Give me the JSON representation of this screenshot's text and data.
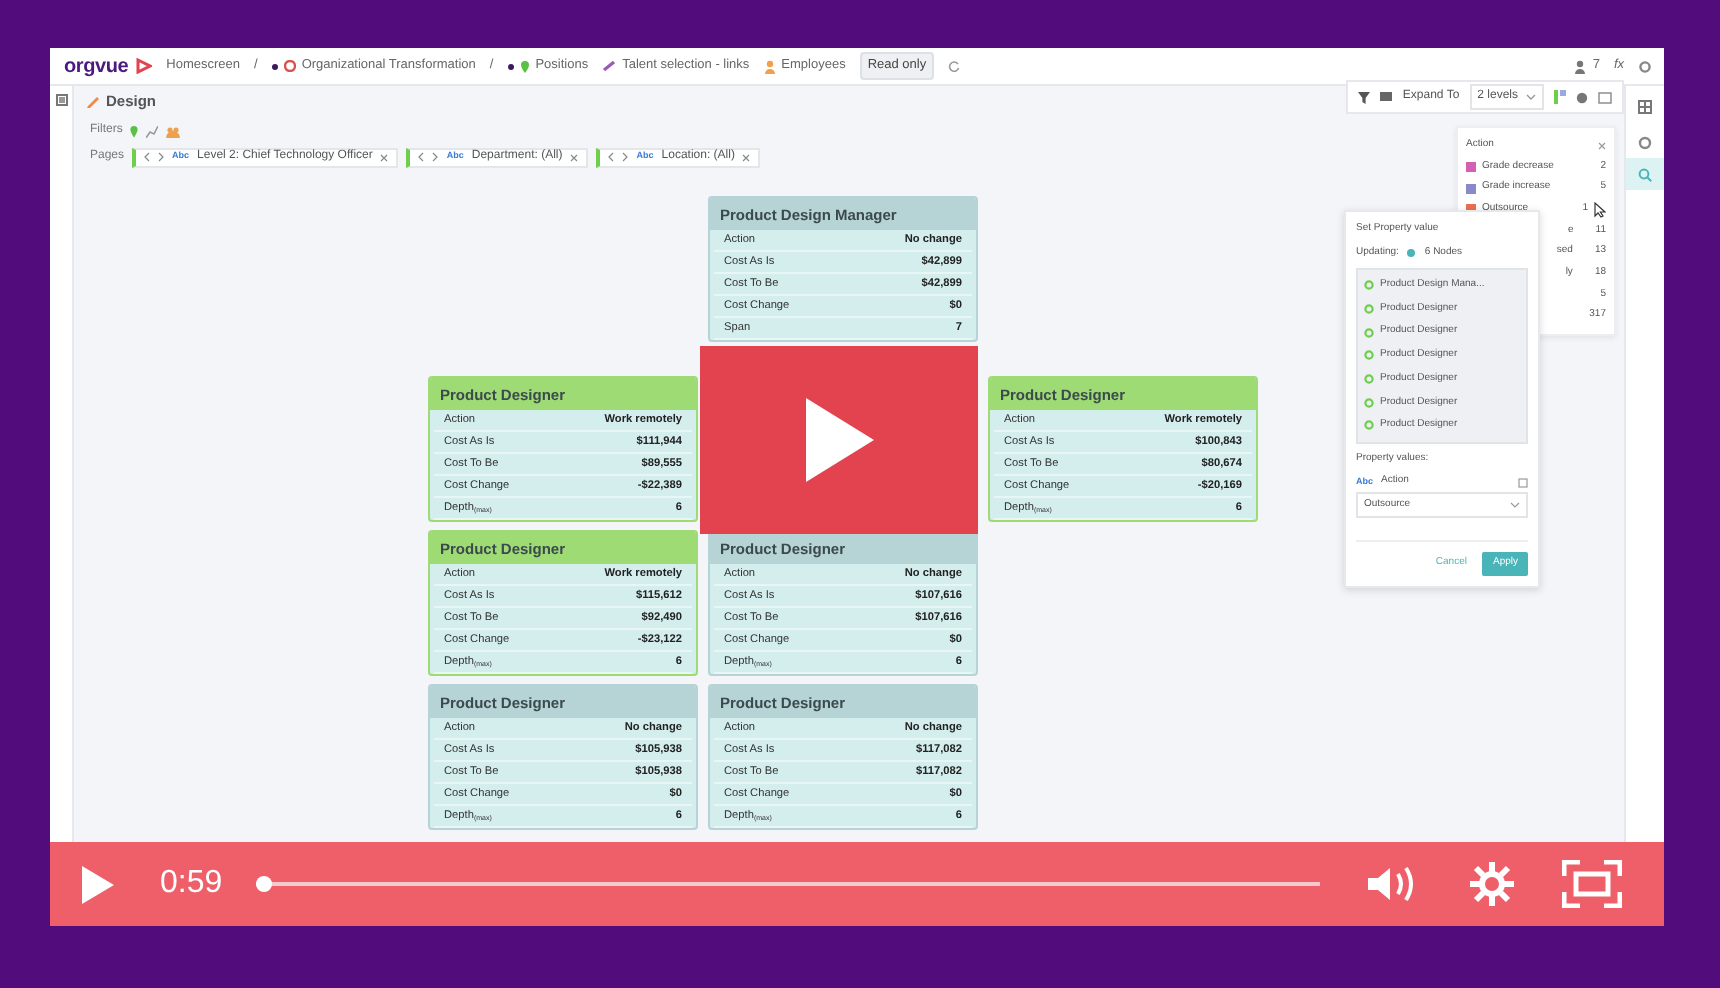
{
  "app": {
    "logo": "orgvue",
    "breadcrumb": [
      {
        "kind": "plain",
        "label": "Homescreen"
      },
      {
        "kind": "separator",
        "label": "/"
      },
      {
        "kind": "dataset",
        "label": "Organizational Transformation"
      },
      {
        "kind": "separator",
        "label": "/"
      },
      {
        "kind": "view",
        "label": "Positions"
      },
      {
        "kind": "link",
        "label": "Talent selection - links"
      },
      {
        "kind": "person",
        "label": "Employees"
      }
    ],
    "badge": "Read only",
    "user_count": "7",
    "formula": "fx",
    "page_title": "Design",
    "toolbar": {
      "expand_label": "Expand To",
      "expand_value": "2 levels"
    },
    "filters_label": "Filters",
    "pages_label": "Pages",
    "pages": [
      {
        "tag": "Abc",
        "label": "Level 2: Chief Technology Officer"
      },
      {
        "tag": "Abc",
        "label": "Department: (All)"
      },
      {
        "tag": "Abc",
        "label": "Location: (All)"
      }
    ],
    "org_chart": {
      "levels": [
        [
          {
            "title": "Product Design Manager",
            "color": "#b6d3d6",
            "rows": [
              {
                "label": "Action",
                "value": "No change"
              },
              {
                "label": "Cost As Is",
                "value": "$42,899"
              },
              {
                "label": "Cost To Be",
                "value": "$42,899"
              },
              {
                "label": "Cost Change",
                "value": "$0"
              },
              {
                "label": "Span",
                "value": "7"
              }
            ]
          }
        ],
        [
          {
            "title": "Product Designer",
            "color": "#9edb74",
            "rows": [
              {
                "label": "Action",
                "value": "Work remotely"
              },
              {
                "label": "Cost As Is",
                "value": "$111,944"
              },
              {
                "label": "Cost To Be",
                "value": "$89,555"
              },
              {
                "label": "Cost Change",
                "value": "-$22,389"
              },
              {
                "label": "Depth$_{(max)}$",
                "value": "6"
              }
            ]
          },
          {
            "title": "Product Designer",
            "color": "#9edb74",
            "rows": [
              {
                "label": "Action",
                "value": "Work remotely"
              },
              {
                "label": "Cost As Is",
                "value": "$100,843"
              },
              {
                "label": "Cost To Be",
                "value": "$80,674"
              },
              {
                "label": "Cost Change",
                "value": "-$20,169"
              },
              {
                "label": "Depth$_{(max)}$",
                "value": "6"
              }
            ]
          }
        ],
        [
          {
            "title": "Product Designer",
            "color": "#9edb74",
            "rows": [
              {
                "label": "Action",
                "value": "Work remotely"
              },
              {
                "label": "Cost As Is",
                "value": "$115,612"
              },
              {
                "label": "Cost To Be",
                "value": "$92,490"
              },
              {
                "label": "Cost Change",
                "value": "-$23,122"
              },
              {
                "label": "Depth$_{(max)}$",
                "value": "6"
              }
            ]
          },
          {
            "title": "Product Designer",
            "color": "#b6d3d6",
            "rows": [
              {
                "label": "Action",
                "value": "No change"
              },
              {
                "label": "Cost As Is",
                "value": "$107,616"
              },
              {
                "label": "Cost To Be",
                "value": "$107,616"
              },
              {
                "label": "Cost Change",
                "value": "$0"
              },
              {
                "label": "Depth$_{(max)}$",
                "value": "6"
              }
            ]
          }
        ],
        [
          {
            "title": "Product Designer",
            "color": "#b6d3d6",
            "rows": [
              {
                "label": "Action",
                "value": "No change"
              },
              {
                "label": "Cost As Is",
                "value": "$105,938"
              },
              {
                "label": "Cost To Be",
                "value": "$105,938"
              },
              {
                "label": "Cost Change",
                "value": "$0"
              },
              {
                "label": "Depth$_{(max)}$",
                "value": "6"
              }
            ]
          },
          {
            "title": "Product Designer",
            "color": "#b6d3d6",
            "rows": [
              {
                "label": "Action",
                "value": "No change"
              },
              {
                "label": "Cost As Is",
                "value": "$117,082"
              },
              {
                "label": "Cost To Be",
                "value": "$117,082"
              },
              {
                "label": "Cost Change",
                "value": "$0"
              },
              {
                "label": "Depth$_{(max)}$",
                "value": "6"
              }
            ]
          }
        ]
      ]
    },
    "legend": {
      "title": "Action",
      "items": [
        {
          "label": "Grade decrease",
          "color": "#d460b2",
          "count": "2"
        },
        {
          "label": "Grade increase",
          "color": "#8c89c9",
          "count": "5"
        },
        {
          "label": "Outsource",
          "color": "#e8704f",
          "count": "1"
        },
        {
          "label": "e",
          "count": "11"
        },
        {
          "label": "sed",
          "count": "13"
        },
        {
          "label": "ly",
          "count": "18"
        },
        {
          "count": "5"
        },
        {
          "count": "317"
        }
      ]
    },
    "popup": {
      "title": "Set Property value",
      "updating_label": "Updating:",
      "updating_value": "6 Nodes",
      "nodes": [
        "Product Design Mana...",
        "Product Designer",
        "Product Designer",
        "Product Designer",
        "Product Designer",
        "Product Designer",
        "Product Designer"
      ],
      "values_label": "Property values:",
      "field_tag": "Abc",
      "field_label": "Action",
      "field_value": "Outsource",
      "cancel": "Cancel",
      "apply": "Apply"
    }
  },
  "video": {
    "time": "0:59",
    "level": 0.006
  }
}
